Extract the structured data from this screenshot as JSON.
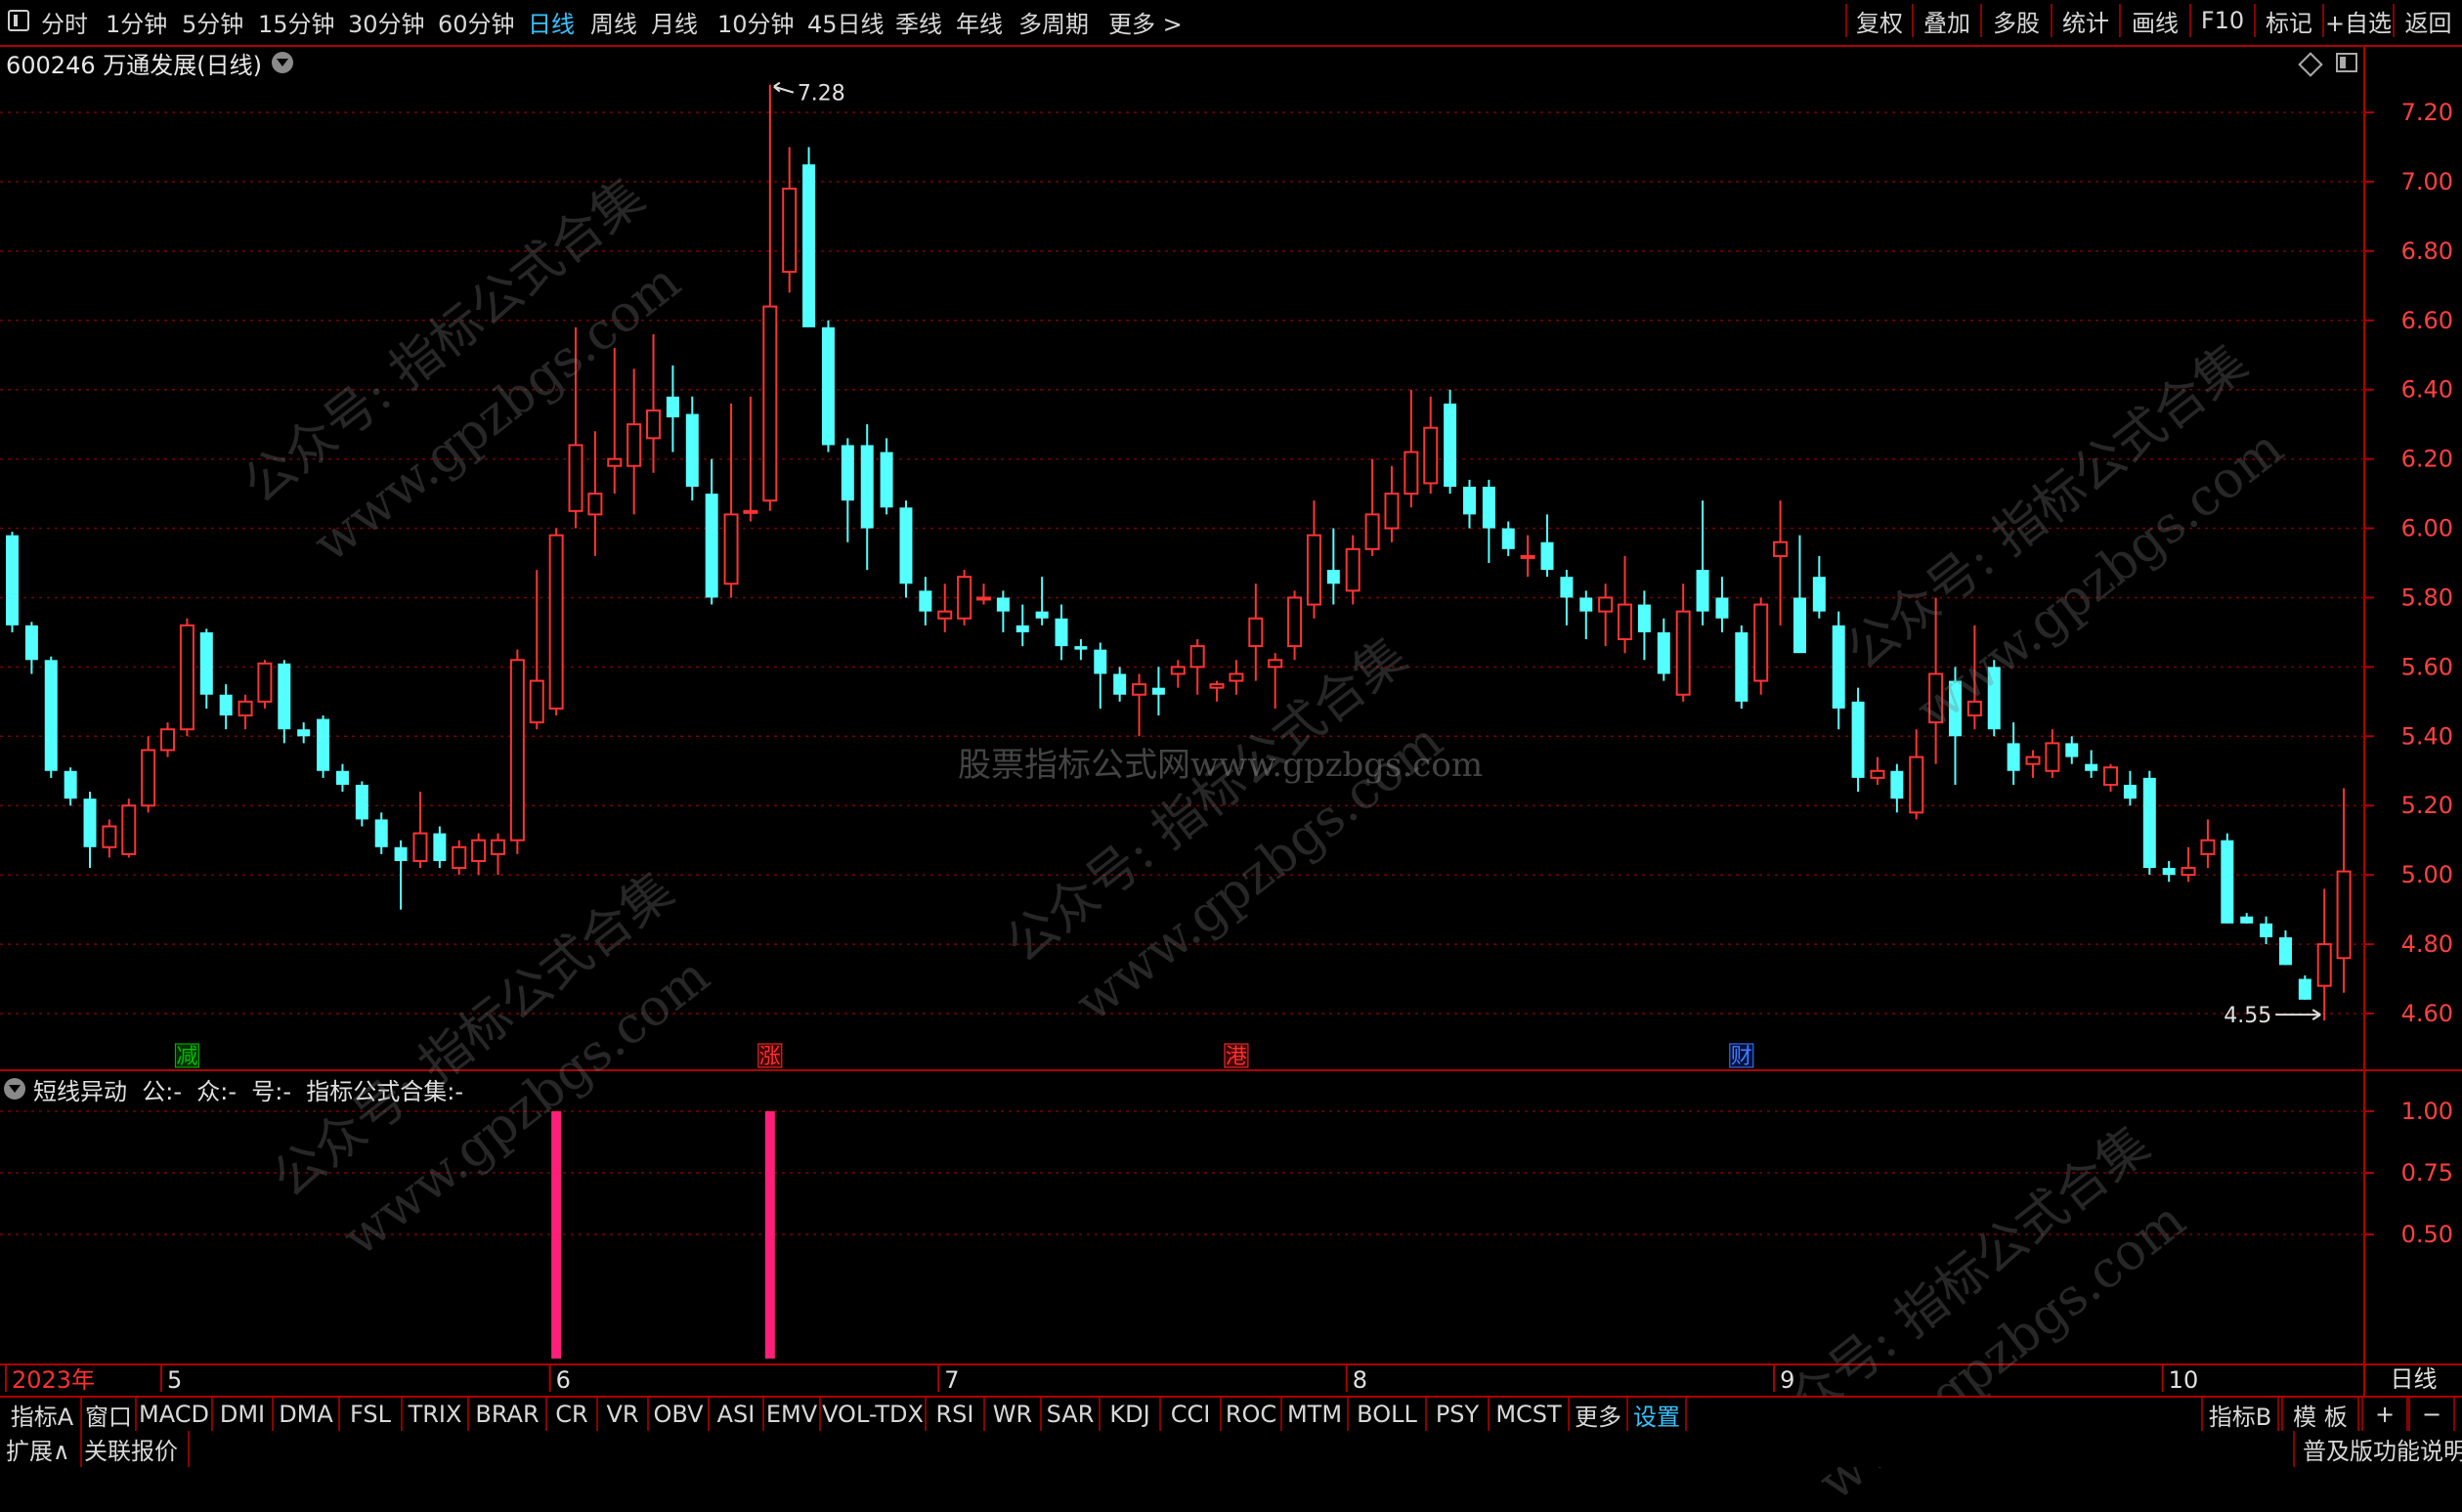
{
  "period_bar": {
    "items": [
      "分时",
      "1分钟",
      "5分钟",
      "15分钟",
      "30分钟",
      "60分钟",
      "日线",
      "周线",
      "月线",
      "10分钟",
      "45日线",
      "季线",
      "年线",
      "多周期",
      "更多 >"
    ],
    "active": "日线",
    "right_buttons": [
      "复权",
      "叠加",
      "多股",
      "统计",
      "画线",
      "F10",
      "标记",
      "+自选",
      "返回"
    ]
  },
  "main_panel": {
    "title": "600246 万通发展(日线)",
    "price_axis": [
      "7.20",
      "7.00",
      "6.80",
      "6.60",
      "6.40",
      "6.20",
      "6.00",
      "5.80",
      "5.60",
      "5.40",
      "5.20",
      "5.00",
      "4.80",
      "4.60"
    ],
    "max_label": "7.28",
    "min_label": "4.55",
    "event_markers": [
      {
        "text": "减",
        "color": "#00c000",
        "bg": "#003000",
        "x_index": 9
      },
      {
        "text": "涨",
        "color": "#ff3030",
        "bg": "#400000",
        "x_index": 39
      },
      {
        "text": "港",
        "color": "#ff3030",
        "bg": "#400000",
        "x_index": 63
      },
      {
        "text": "财",
        "color": "#4080ff",
        "bg": "#001040",
        "x_index": 89
      }
    ]
  },
  "indicator_panel": {
    "title": "短线异动  公:-  众:-  号:-  指标公式合集:-",
    "axis": [
      "1.00",
      "0.75",
      "0.50"
    ],
    "signals": [
      {
        "x_index": 28,
        "value": 1
      },
      {
        "x_index": 39,
        "value": 1
      }
    ]
  },
  "date_axis": {
    "labels": [
      {
        "text": "2023年",
        "x_index": 0,
        "red": true
      },
      {
        "text": "5",
        "x_index": 8
      },
      {
        "text": "6",
        "x_index": 28
      },
      {
        "text": "7",
        "x_index": 48
      },
      {
        "text": "8",
        "x_index": 69
      },
      {
        "text": "9",
        "x_index": 91
      },
      {
        "text": "10",
        "x_index": 111
      }
    ],
    "period_label": "日线"
  },
  "indicator_tabs": {
    "items": [
      "指标A",
      "窗口",
      "MACD",
      "DMI",
      "DMA",
      "FSL",
      "TRIX",
      "BRAR",
      "CR",
      "VR",
      "OBV",
      "ASI",
      "EMV",
      "VOL-TDX",
      "RSI",
      "WR",
      "SAR",
      "KDJ",
      "CCI",
      "ROC",
      "MTM",
      "BOLL",
      "PSY",
      "MCST",
      "更多",
      "设置"
    ],
    "active": "设置",
    "right_items": [
      "指标B",
      "模 板",
      "+",
      "−"
    ]
  },
  "status_bar": {
    "left": [
      "扩展∧",
      "关联报价"
    ],
    "right": "普及版功能说明"
  },
  "watermarks": {
    "line1": "公众号: 指标公式合集",
    "line2": "www.gpzbgs.com",
    "center": "股票指标公式网www.gpzbgs.com"
  },
  "colors": {
    "up": "#ff3333",
    "down": "#54ffff",
    "signal": "#ff1f7a",
    "grid": "#7a0000",
    "border": "#b00000"
  },
  "chart_data": {
    "type": "candlestick",
    "symbol": "600246 万通发展",
    "period": "日线",
    "ylim": [
      4.5,
      7.3
    ],
    "candles": [
      [
        5.98,
        5.99,
        5.7,
        5.72
      ],
      [
        5.72,
        5.73,
        5.58,
        5.62
      ],
      [
        5.62,
        5.63,
        5.28,
        5.3
      ],
      [
        5.3,
        5.31,
        5.2,
        5.22
      ],
      [
        5.22,
        5.24,
        5.02,
        5.08
      ],
      [
        5.08,
        5.16,
        5.05,
        5.14
      ],
      [
        5.06,
        5.22,
        5.05,
        5.2
      ],
      [
        5.2,
        5.4,
        5.18,
        5.36
      ],
      [
        5.36,
        5.44,
        5.34,
        5.42
      ],
      [
        5.42,
        5.74,
        5.4,
        5.72
      ],
      [
        5.7,
        5.71,
        5.48,
        5.52
      ],
      [
        5.52,
        5.55,
        5.42,
        5.46
      ],
      [
        5.46,
        5.52,
        5.42,
        5.5
      ],
      [
        5.5,
        5.62,
        5.48,
        5.61
      ],
      [
        5.61,
        5.62,
        5.38,
        5.42
      ],
      [
        5.42,
        5.44,
        5.38,
        5.4
      ],
      [
        5.45,
        5.46,
        5.28,
        5.3
      ],
      [
        5.3,
        5.32,
        5.24,
        5.26
      ],
      [
        5.26,
        5.27,
        5.14,
        5.16
      ],
      [
        5.16,
        5.18,
        5.06,
        5.08
      ],
      [
        5.08,
        5.1,
        4.9,
        5.04
      ],
      [
        5.04,
        5.24,
        5.02,
        5.12
      ],
      [
        5.12,
        5.14,
        5.02,
        5.04
      ],
      [
        5.02,
        5.1,
        5.0,
        5.08
      ],
      [
        5.04,
        5.12,
        5.0,
        5.1
      ],
      [
        5.06,
        5.12,
        5.0,
        5.1
      ],
      [
        5.1,
        5.65,
        5.06,
        5.62
      ],
      [
        5.44,
        5.88,
        5.42,
        5.56
      ],
      [
        5.48,
        6.0,
        5.46,
        5.98
      ],
      [
        6.05,
        6.58,
        6.0,
        6.24
      ],
      [
        6.04,
        6.28,
        5.92,
        6.1
      ],
      [
        6.18,
        6.52,
        6.1,
        6.2
      ],
      [
        6.18,
        6.46,
        6.04,
        6.3
      ],
      [
        6.26,
        6.56,
        6.16,
        6.34
      ],
      [
        6.38,
        6.47,
        6.22,
        6.32
      ],
      [
        6.33,
        6.38,
        6.08,
        6.12
      ],
      [
        6.1,
        6.2,
        5.78,
        5.8
      ],
      [
        5.84,
        6.36,
        5.8,
        6.04
      ],
      [
        6.05,
        6.38,
        6.02,
        6.05
      ],
      [
        6.08,
        7.28,
        6.05,
        6.64
      ],
      [
        6.74,
        7.1,
        6.68,
        6.98
      ],
      [
        7.05,
        7.1,
        6.6,
        6.58
      ],
      [
        6.58,
        6.6,
        6.22,
        6.24
      ],
      [
        6.24,
        6.26,
        5.96,
        6.08
      ],
      [
        6.24,
        6.3,
        5.88,
        6.0
      ],
      [
        6.22,
        6.26,
        6.04,
        6.06
      ],
      [
        6.06,
        6.08,
        5.8,
        5.84
      ],
      [
        5.82,
        5.86,
        5.72,
        5.76
      ],
      [
        5.74,
        5.84,
        5.7,
        5.76
      ],
      [
        5.74,
        5.88,
        5.72,
        5.86
      ],
      [
        5.8,
        5.84,
        5.78,
        5.8
      ],
      [
        5.8,
        5.82,
        5.7,
        5.76
      ],
      [
        5.72,
        5.78,
        5.66,
        5.7
      ],
      [
        5.76,
        5.86,
        5.72,
        5.74
      ],
      [
        5.74,
        5.78,
        5.62,
        5.66
      ],
      [
        5.66,
        5.68,
        5.62,
        5.65
      ],
      [
        5.65,
        5.67,
        5.48,
        5.58
      ],
      [
        5.58,
        5.6,
        5.5,
        5.52
      ],
      [
        5.52,
        5.58,
        5.4,
        5.55
      ],
      [
        5.54,
        5.6,
        5.46,
        5.52
      ],
      [
        5.58,
        5.62,
        5.54,
        5.6
      ],
      [
        5.6,
        5.68,
        5.52,
        5.66
      ],
      [
        5.54,
        5.56,
        5.5,
        5.55
      ],
      [
        5.56,
        5.62,
        5.52,
        5.58
      ],
      [
        5.66,
        5.84,
        5.56,
        5.74
      ],
      [
        5.6,
        5.64,
        5.48,
        5.62
      ],
      [
        5.66,
        5.82,
        5.62,
        5.8
      ],
      [
        5.78,
        6.08,
        5.74,
        5.98
      ],
      [
        5.88,
        6.0,
        5.78,
        5.84
      ],
      [
        5.82,
        5.98,
        5.78,
        5.94
      ],
      [
        5.94,
        6.2,
        5.92,
        6.04
      ],
      [
        6.0,
        6.18,
        5.96,
        6.1
      ],
      [
        6.1,
        6.4,
        6.06,
        6.22
      ],
      [
        6.13,
        6.38,
        6.1,
        6.29
      ],
      [
        6.36,
        6.4,
        6.1,
        6.12
      ],
      [
        6.12,
        6.14,
        6.0,
        6.04
      ],
      [
        6.12,
        6.14,
        5.9,
        6.0
      ],
      [
        6.0,
        6.02,
        5.92,
        5.94
      ],
      [
        5.92,
        5.98,
        5.86,
        5.92
      ],
      [
        5.96,
        6.04,
        5.86,
        5.88
      ],
      [
        5.86,
        5.88,
        5.72,
        5.8
      ],
      [
        5.8,
        5.82,
        5.68,
        5.76
      ],
      [
        5.76,
        5.84,
        5.66,
        5.8
      ],
      [
        5.68,
        5.92,
        5.64,
        5.78
      ],
      [
        5.78,
        5.82,
        5.62,
        5.7
      ],
      [
        5.7,
        5.74,
        5.56,
        5.58
      ],
      [
        5.52,
        5.84,
        5.5,
        5.76
      ],
      [
        5.88,
        6.08,
        5.72,
        5.76
      ],
      [
        5.8,
        5.86,
        5.7,
        5.74
      ],
      [
        5.7,
        5.72,
        5.48,
        5.5
      ],
      [
        5.56,
        5.8,
        5.52,
        5.78
      ],
      [
        5.92,
        6.08,
        5.72,
        5.96
      ],
      [
        5.8,
        5.98,
        5.66,
        5.64
      ],
      [
        5.86,
        5.92,
        5.74,
        5.76
      ],
      [
        5.72,
        5.76,
        5.42,
        5.48
      ],
      [
        5.5,
        5.54,
        5.24,
        5.28
      ],
      [
        5.28,
        5.34,
        5.26,
        5.3
      ],
      [
        5.3,
        5.32,
        5.18,
        5.22
      ],
      [
        5.18,
        5.42,
        5.16,
        5.34
      ],
      [
        5.44,
        5.8,
        5.32,
        5.58
      ],
      [
        5.56,
        5.6,
        5.26,
        5.4
      ],
      [
        5.46,
        5.72,
        5.42,
        5.5
      ],
      [
        5.6,
        5.62,
        5.4,
        5.42
      ],
      [
        5.38,
        5.44,
        5.26,
        5.3
      ],
      [
        5.32,
        5.36,
        5.28,
        5.34
      ],
      [
        5.3,
        5.42,
        5.28,
        5.38
      ],
      [
        5.38,
        5.4,
        5.32,
        5.34
      ],
      [
        5.32,
        5.36,
        5.28,
        5.3
      ],
      [
        5.26,
        5.32,
        5.24,
        5.31
      ],
      [
        5.26,
        5.3,
        5.2,
        5.22
      ],
      [
        5.28,
        5.3,
        5.0,
        5.02
      ],
      [
        5.02,
        5.04,
        4.98,
        5.0
      ],
      [
        5.0,
        5.08,
        4.98,
        5.02
      ],
      [
        5.06,
        5.16,
        5.02,
        5.1
      ],
      [
        5.1,
        5.12,
        4.86,
        4.86
      ],
      [
        4.88,
        4.89,
        4.86,
        4.86
      ],
      [
        4.86,
        4.88,
        4.8,
        4.82
      ],
      [
        4.82,
        4.84,
        4.74,
        4.74
      ],
      [
        4.7,
        4.71,
        4.64,
        4.64
      ],
      [
        4.68,
        4.96,
        4.58,
        4.8
      ],
      [
        4.76,
        5.25,
        4.66,
        5.01
      ]
    ]
  }
}
